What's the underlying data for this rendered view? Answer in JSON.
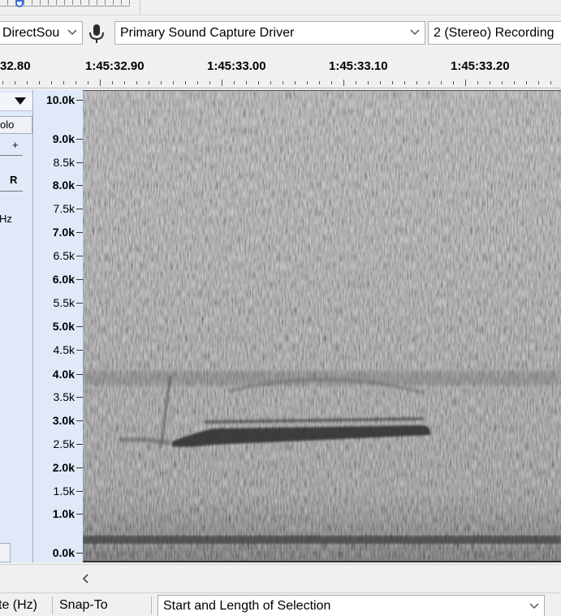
{
  "meter_toolbar": {},
  "device_toolbar": {
    "host": "DirectSou",
    "input_device": "Primary Sound Capture Driver",
    "channels": "2 (Stereo) Recording"
  },
  "ruler": {
    "labels": [
      "32.80",
      "1:45:32.90",
      "1:45:33.00",
      "1:45:33.10",
      "1:45:33.20"
    ]
  },
  "track_panel": {
    "solo": "olo",
    "gain_plus": "+",
    "pan_right": "R",
    "rate_fragment": "Hz"
  },
  "frequency_scale": {
    "labels": [
      "10.0k",
      "9.0k",
      "8.5k",
      "8.0k",
      "7.5k",
      "7.0k",
      "6.5k",
      "6.0k",
      "5.5k",
      "5.0k",
      "4.5k",
      "4.0k",
      "3.5k",
      "3.0k",
      "2.5k",
      "2.0k",
      "1.5k",
      "1.0k",
      "0.0k"
    ]
  },
  "selection_toolbar": {
    "rate_label": "te (Hz)",
    "snap_label": "Snap-To",
    "selection_mode": "Start and Length of Selection"
  }
}
